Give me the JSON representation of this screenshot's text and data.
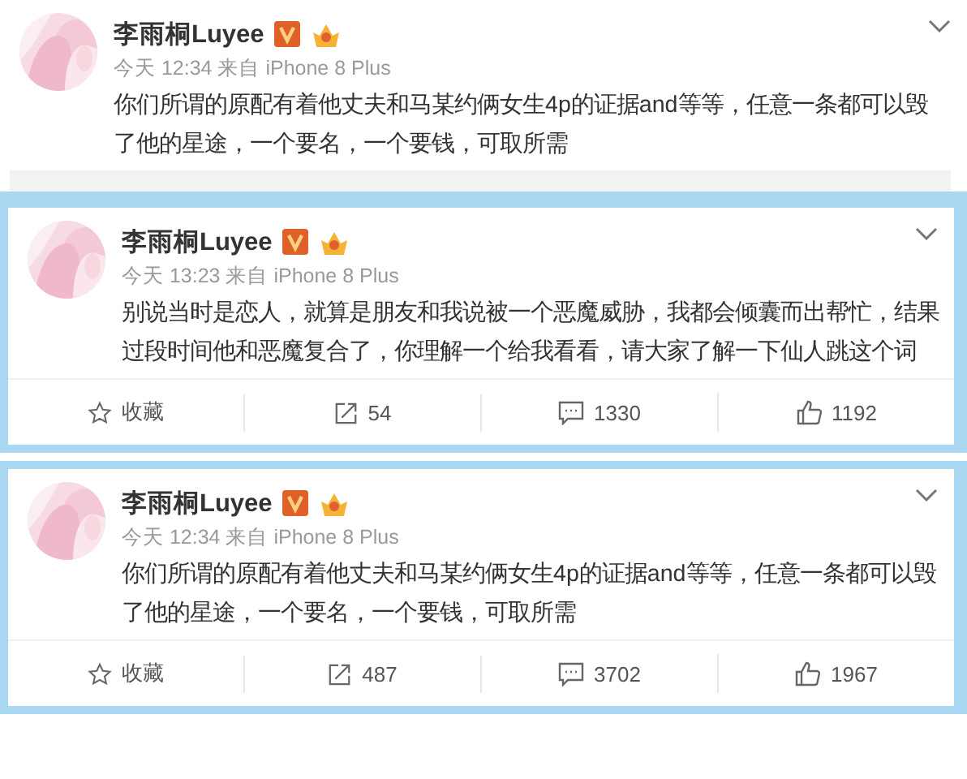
{
  "posts": [
    {
      "name": "李雨桐Luyee",
      "meta": "今天 12:34 来自 iPhone 8 Plus",
      "text": "你们所谓的原配有着他丈夫和马某约俩女生4p的证据and等等，任意一条都可以毁了他的星途，一个要名，一个要钱，可取所需"
    },
    {
      "name": "李雨桐Luyee",
      "meta": "今天 13:23 来自 iPhone 8 Plus",
      "text": "别说当时是恋人，就算是朋友和我说被一个恶魔威胁，我都会倾囊而出帮忙，结果过段时间他和恶魔复合了，你理解一个给我看看，请大家了解一下仙人跳这个词",
      "actions": [
        {
          "kind": "favorite",
          "label": "收藏"
        },
        {
          "kind": "repost",
          "label": "54"
        },
        {
          "kind": "comment",
          "label": "1330"
        },
        {
          "kind": "like",
          "label": "1192"
        }
      ]
    },
    {
      "name": "李雨桐Luyee",
      "meta": "今天 12:34 来自 iPhone 8 Plus",
      "text": "你们所谓的原配有着他丈夫和马某约俩女生4p的证据and等等，任意一条都可以毁了他的星途，一个要名，一个要钱，可取所需",
      "actions": [
        {
          "kind": "favorite",
          "label": "收藏"
        },
        {
          "kind": "repost",
          "label": "487"
        },
        {
          "kind": "comment",
          "label": "3702"
        },
        {
          "kind": "like",
          "label": "1967"
        }
      ]
    }
  ]
}
